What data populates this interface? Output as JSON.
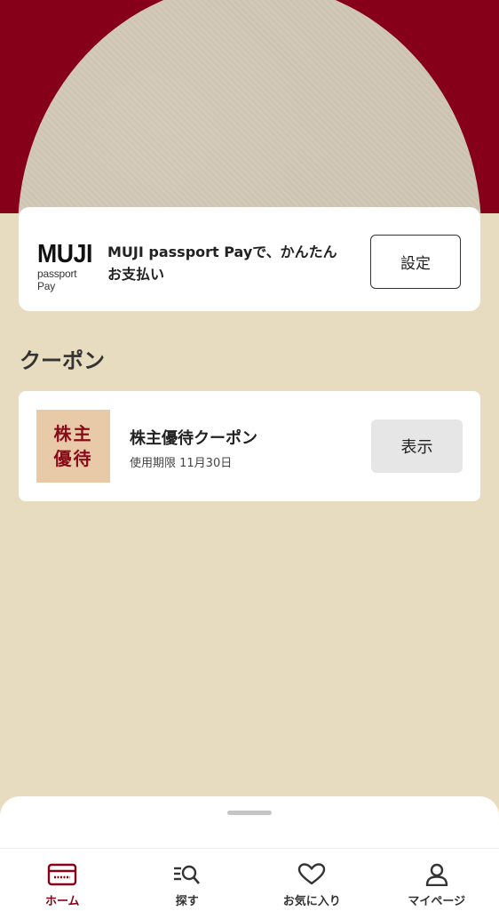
{
  "hero": {
    "bg_color": "#850018"
  },
  "pay_card": {
    "logo_word": "MUJI",
    "logo_sub": "passport Pay",
    "description": "MUJI passport Payで、かんたんお支払い",
    "setting_label": "設定"
  },
  "coupon_section": {
    "title": "クーポン",
    "items": [
      {
        "thumb_text": "株主優待",
        "name": "株主優待クーポン",
        "expiry": "使用期限 11月30日",
        "action_label": "表示"
      }
    ]
  },
  "tabbar": {
    "active_color": "#8a0018",
    "items": [
      {
        "label": "ホーム",
        "icon": "card-icon",
        "active": true
      },
      {
        "label": "探す",
        "icon": "search-list-icon",
        "active": false
      },
      {
        "label": "お気に入り",
        "icon": "heart-icon",
        "active": false
      },
      {
        "label": "マイページ",
        "icon": "person-icon",
        "active": false
      }
    ]
  }
}
